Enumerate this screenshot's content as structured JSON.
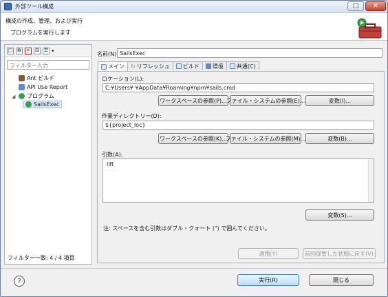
{
  "window": {
    "title": "外部ツール構成",
    "minimize_glyph": "–",
    "maximize_glyph": "□",
    "close_glyph": "✕"
  },
  "header": {
    "title": "構成の作成、管理、および実行",
    "subtitle": "プログラムを実行します"
  },
  "left_panel": {
    "filter_placeholder": "フィルター入力",
    "tree": [
      {
        "label": "Ant ビルド",
        "icon": "ant-icon",
        "expander": ""
      },
      {
        "label": "API Use Report",
        "icon": "report-icon",
        "expander": ""
      },
      {
        "label": "プログラム",
        "icon": "program-icon",
        "expander": "◢"
      },
      {
        "label": "SailsExec",
        "icon": "program-icon",
        "expander": "",
        "selected": true
      }
    ],
    "status": "フィルター一致: 4 / 4 項目"
  },
  "config": {
    "name_label": "名前(N):",
    "name_value": "SailsExec",
    "tabs": [
      {
        "label": "メイン",
        "active": true
      },
      {
        "label": "リフレッシュ",
        "active": false
      },
      {
        "label": "ビルド",
        "active": false
      },
      {
        "label": "環境",
        "active": false
      },
      {
        "label": "共通(C)",
        "active": false
      }
    ],
    "location": {
      "label": "ロケーション(L):",
      "value": "C:¥Users¥          ¥AppData¥Roaming¥npm¥sails.cmd",
      "btn_workspace": "ワークスペースの参照(P)...",
      "btn_filesystem": "ファイル・システムの参照(E)...",
      "btn_variables": "変数(I)..."
    },
    "workdir": {
      "label": "作業ディレクトリー(D):",
      "value": "${project_loc}",
      "btn_workspace": "ワークスペースの参照(K)...",
      "btn_filesystem": "ファイル・システムの参照(M)...",
      "btn_variables": "変数(B)..."
    },
    "args": {
      "label": "引数(A):",
      "value": "lift",
      "btn_variables": "変数(S)..."
    },
    "note": "注: スペースを含む引数はダブル・クォート (\") で囲んでください。",
    "btn_apply": "適用(Y)",
    "btn_revert": "前回保管した状態に戻す(V)"
  },
  "footer": {
    "help_glyph": "?",
    "btn_run": "実行(R)",
    "btn_close": "閉じる"
  },
  "colors": {
    "accent": "#3c7fb1",
    "toolbox_red": "#c0403a"
  }
}
